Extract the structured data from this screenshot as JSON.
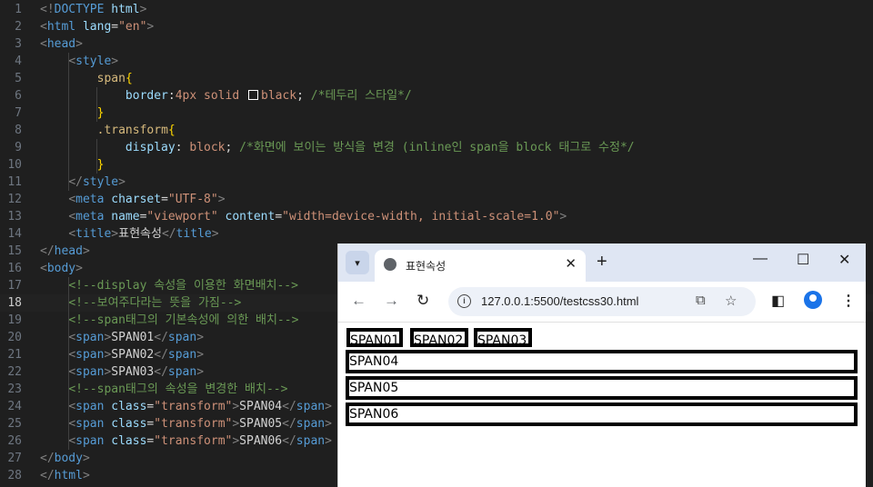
{
  "editor": {
    "active_line": "18",
    "lines": [
      {
        "n": "1",
        "parts": [
          {
            "c": "tag",
            "t": "<!"
          },
          {
            "c": "tn",
            "t": "DOCTYPE"
          },
          {
            "c": "at",
            "t": " html"
          },
          {
            "c": "tag",
            "t": ">"
          }
        ]
      },
      {
        "n": "2",
        "parts": [
          {
            "c": "tag",
            "t": "<"
          },
          {
            "c": "tn",
            "t": "html"
          },
          {
            "c": "at",
            "t": " lang"
          },
          {
            "c": "tx",
            "t": "="
          },
          {
            "c": "av",
            "t": "\"en\""
          },
          {
            "c": "tag",
            "t": ">"
          }
        ]
      },
      {
        "n": "3",
        "parts": [
          {
            "c": "tag",
            "t": "<"
          },
          {
            "c": "tn",
            "t": "head"
          },
          {
            "c": "tag",
            "t": ">"
          }
        ]
      },
      {
        "n": "4",
        "parts": [
          {
            "c": "tx",
            "t": "    "
          },
          {
            "c": "tag",
            "t": "<"
          },
          {
            "c": "tn",
            "t": "style"
          },
          {
            "c": "tag",
            "t": ">"
          }
        ]
      },
      {
        "n": "5",
        "parts": [
          {
            "c": "tx",
            "t": "        "
          },
          {
            "c": "sel",
            "t": "span"
          },
          {
            "c": "br",
            "t": "{"
          }
        ]
      },
      {
        "n": "6",
        "parts": [
          {
            "c": "tx",
            "t": "            "
          },
          {
            "c": "pr",
            "t": "border"
          },
          {
            "c": "tx",
            "t": ":"
          },
          {
            "c": "vl",
            "t": "4px solid "
          },
          {
            "c": "swatch",
            "t": ""
          },
          {
            "c": "vl",
            "t": "black"
          },
          {
            "c": "tx",
            "t": "; "
          },
          {
            "c": "cm",
            "t": "/*테두리 스타일*/"
          }
        ]
      },
      {
        "n": "7",
        "parts": [
          {
            "c": "tx",
            "t": "        "
          },
          {
            "c": "br",
            "t": "}"
          }
        ]
      },
      {
        "n": "8",
        "parts": [
          {
            "c": "tx",
            "t": "        "
          },
          {
            "c": "sel",
            "t": ".transform"
          },
          {
            "c": "br",
            "t": "{"
          }
        ]
      },
      {
        "n": "9",
        "parts": [
          {
            "c": "tx",
            "t": "            "
          },
          {
            "c": "pr",
            "t": "display"
          },
          {
            "c": "tx",
            "t": ": "
          },
          {
            "c": "vl",
            "t": "block"
          },
          {
            "c": "tx",
            "t": "; "
          },
          {
            "c": "cm",
            "t": "/*화면에 보이는 방식을 변경 (inline인 span을 block 태그로 수정*/"
          }
        ]
      },
      {
        "n": "10",
        "parts": [
          {
            "c": "tx",
            "t": "        "
          },
          {
            "c": "br",
            "t": "}"
          }
        ]
      },
      {
        "n": "11",
        "parts": [
          {
            "c": "tx",
            "t": "    "
          },
          {
            "c": "tag",
            "t": "</"
          },
          {
            "c": "tn",
            "t": "style"
          },
          {
            "c": "tag",
            "t": ">"
          }
        ]
      },
      {
        "n": "12",
        "parts": [
          {
            "c": "tx",
            "t": "    "
          },
          {
            "c": "tag",
            "t": "<"
          },
          {
            "c": "tn",
            "t": "meta"
          },
          {
            "c": "at",
            "t": " charset"
          },
          {
            "c": "tx",
            "t": "="
          },
          {
            "c": "av",
            "t": "\"UTF-8\""
          },
          {
            "c": "tag",
            "t": ">"
          }
        ]
      },
      {
        "n": "13",
        "parts": [
          {
            "c": "tx",
            "t": "    "
          },
          {
            "c": "tag",
            "t": "<"
          },
          {
            "c": "tn",
            "t": "meta"
          },
          {
            "c": "at",
            "t": " name"
          },
          {
            "c": "tx",
            "t": "="
          },
          {
            "c": "av",
            "t": "\"viewport\""
          },
          {
            "c": "at",
            "t": " content"
          },
          {
            "c": "tx",
            "t": "="
          },
          {
            "c": "av",
            "t": "\"width=device-width, initial-scale=1.0\""
          },
          {
            "c": "tag",
            "t": ">"
          }
        ]
      },
      {
        "n": "14",
        "parts": [
          {
            "c": "tx",
            "t": "    "
          },
          {
            "c": "tag",
            "t": "<"
          },
          {
            "c": "tn",
            "t": "title"
          },
          {
            "c": "tag",
            "t": ">"
          },
          {
            "c": "tx",
            "t": "표현속성"
          },
          {
            "c": "tag",
            "t": "</"
          },
          {
            "c": "tn",
            "t": "title"
          },
          {
            "c": "tag",
            "t": ">"
          }
        ]
      },
      {
        "n": "15",
        "parts": [
          {
            "c": "tag",
            "t": "</"
          },
          {
            "c": "tn",
            "t": "head"
          },
          {
            "c": "tag",
            "t": ">"
          }
        ]
      },
      {
        "n": "16",
        "parts": [
          {
            "c": "tag",
            "t": "<"
          },
          {
            "c": "tn",
            "t": "body"
          },
          {
            "c": "tag",
            "t": ">"
          }
        ]
      },
      {
        "n": "17",
        "parts": [
          {
            "c": "tx",
            "t": "    "
          },
          {
            "c": "cm",
            "t": "<!--display 속성을 이용한 화면배치-->"
          }
        ]
      },
      {
        "n": "18",
        "parts": [
          {
            "c": "tx",
            "t": "    "
          },
          {
            "c": "cm",
            "t": "<!--보여주다라는 뜻을 가짐-->"
          }
        ]
      },
      {
        "n": "19",
        "parts": [
          {
            "c": "tx",
            "t": "    "
          },
          {
            "c": "cm",
            "t": "<!--span태그의 기본속성에 의한 배치-->"
          }
        ]
      },
      {
        "n": "20",
        "parts": [
          {
            "c": "tx",
            "t": "    "
          },
          {
            "c": "tag",
            "t": "<"
          },
          {
            "c": "tn",
            "t": "span"
          },
          {
            "c": "tag",
            "t": ">"
          },
          {
            "c": "tx",
            "t": "SPAN01"
          },
          {
            "c": "tag",
            "t": "</"
          },
          {
            "c": "tn",
            "t": "span"
          },
          {
            "c": "tag",
            "t": ">"
          }
        ]
      },
      {
        "n": "21",
        "parts": [
          {
            "c": "tx",
            "t": "    "
          },
          {
            "c": "tag",
            "t": "<"
          },
          {
            "c": "tn",
            "t": "span"
          },
          {
            "c": "tag",
            "t": ">"
          },
          {
            "c": "tx",
            "t": "SPAN02"
          },
          {
            "c": "tag",
            "t": "</"
          },
          {
            "c": "tn",
            "t": "span"
          },
          {
            "c": "tag",
            "t": ">"
          }
        ]
      },
      {
        "n": "22",
        "parts": [
          {
            "c": "tx",
            "t": "    "
          },
          {
            "c": "tag",
            "t": "<"
          },
          {
            "c": "tn",
            "t": "span"
          },
          {
            "c": "tag",
            "t": ">"
          },
          {
            "c": "tx",
            "t": "SPAN03"
          },
          {
            "c": "tag",
            "t": "</"
          },
          {
            "c": "tn",
            "t": "span"
          },
          {
            "c": "tag",
            "t": ">"
          }
        ]
      },
      {
        "n": "23",
        "parts": [
          {
            "c": "tx",
            "t": "    "
          },
          {
            "c": "cm",
            "t": "<!--span태그의 속성을 변경한 배치-->"
          }
        ]
      },
      {
        "n": "24",
        "parts": [
          {
            "c": "tx",
            "t": "    "
          },
          {
            "c": "tag",
            "t": "<"
          },
          {
            "c": "tn",
            "t": "span"
          },
          {
            "c": "at",
            "t": " class"
          },
          {
            "c": "tx",
            "t": "="
          },
          {
            "c": "av",
            "t": "\"transform\""
          },
          {
            "c": "tag",
            "t": ">"
          },
          {
            "c": "tx",
            "t": "SPAN04"
          },
          {
            "c": "tag",
            "t": "</"
          },
          {
            "c": "tn",
            "t": "span"
          },
          {
            "c": "tag",
            "t": ">"
          }
        ]
      },
      {
        "n": "25",
        "parts": [
          {
            "c": "tx",
            "t": "    "
          },
          {
            "c": "tag",
            "t": "<"
          },
          {
            "c": "tn",
            "t": "span"
          },
          {
            "c": "at",
            "t": " class"
          },
          {
            "c": "tx",
            "t": "="
          },
          {
            "c": "av",
            "t": "\"transform\""
          },
          {
            "c": "tag",
            "t": ">"
          },
          {
            "c": "tx",
            "t": "SPAN05"
          },
          {
            "c": "tag",
            "t": "</"
          },
          {
            "c": "tn",
            "t": "span"
          },
          {
            "c": "tag",
            "t": ">"
          }
        ]
      },
      {
        "n": "26",
        "parts": [
          {
            "c": "tx",
            "t": "    "
          },
          {
            "c": "tag",
            "t": "<"
          },
          {
            "c": "tn",
            "t": "span"
          },
          {
            "c": "at",
            "t": " class"
          },
          {
            "c": "tx",
            "t": "="
          },
          {
            "c": "av",
            "t": "\"transform\""
          },
          {
            "c": "tag",
            "t": ">"
          },
          {
            "c": "tx",
            "t": "SPAN06"
          },
          {
            "c": "tag",
            "t": "</"
          },
          {
            "c": "tn",
            "t": "span"
          },
          {
            "c": "tag",
            "t": ">"
          }
        ]
      },
      {
        "n": "27",
        "parts": [
          {
            "c": "tag",
            "t": "</"
          },
          {
            "c": "tn",
            "t": "body"
          },
          {
            "c": "tag",
            "t": ">"
          }
        ]
      },
      {
        "n": "28",
        "parts": [
          {
            "c": "tag",
            "t": "</"
          },
          {
            "c": "tn",
            "t": "html"
          },
          {
            "c": "tag",
            "t": ">"
          }
        ]
      }
    ]
  },
  "browser": {
    "tab_title": "표현속성",
    "url": "127.0.0.1:5500/testcss30.html",
    "icons": {
      "tab_search": "chevron-down-icon",
      "favicon": "globe-icon",
      "close_tab": "close-icon",
      "new_tab": "plus-icon",
      "minimize": "minimize-icon",
      "maximize": "maximize-icon",
      "close_window": "close-icon",
      "back": "arrow-left-icon",
      "forward": "arrow-right-icon",
      "reload": "reload-icon",
      "site_info": "info-icon",
      "translate": "translate-icon",
      "bookmark": "star-icon",
      "side_panel": "side-panel-icon",
      "profile": "profile-icon",
      "menu": "kebab-menu-icon"
    },
    "page": {
      "inline_spans": [
        "SPAN01",
        "SPAN02",
        "SPAN03"
      ],
      "block_spans": [
        "SPAN04",
        "SPAN05",
        "SPAN06"
      ]
    }
  }
}
